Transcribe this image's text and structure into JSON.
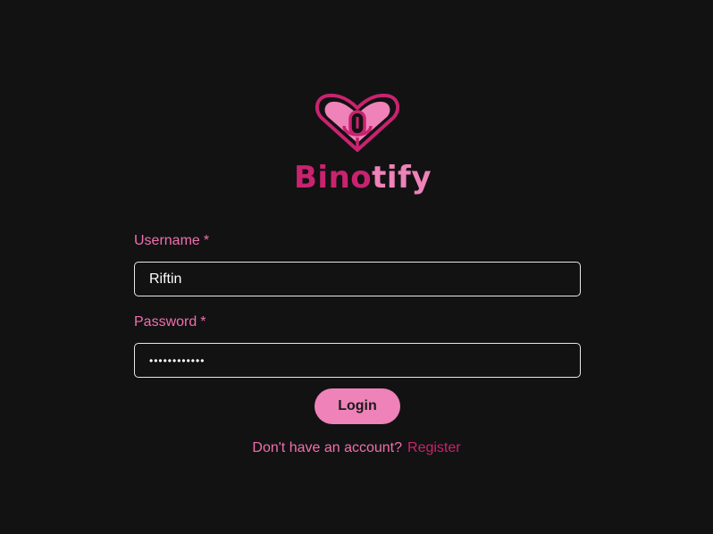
{
  "brand": {
    "name_part1": "Bino",
    "name_part2": "tify",
    "logo_icon": "heart-microphone-icon",
    "colors": {
      "primary": "#c9236f",
      "accent": "#ee82b9",
      "background": "#121212"
    }
  },
  "form": {
    "username": {
      "label": "Username",
      "required_mark": "*",
      "value": "Riftin"
    },
    "password": {
      "label": "Password",
      "required_mark": "*",
      "value": "••••••••••••"
    },
    "submit_label": "Login"
  },
  "footer": {
    "prompt": "Don't have an account?",
    "link_label": "Register"
  }
}
